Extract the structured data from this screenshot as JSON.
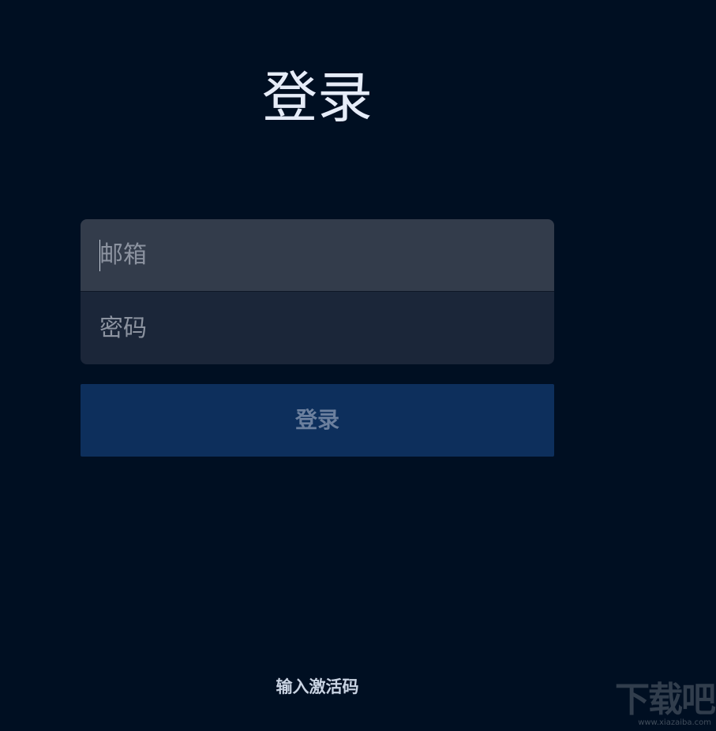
{
  "header": {
    "title": "登录"
  },
  "form": {
    "email": {
      "value": "",
      "placeholder": "邮箱"
    },
    "password": {
      "value": "",
      "placeholder": "密码"
    },
    "submit_label": "登录"
  },
  "footer": {
    "activation_label": "输入激活码"
  },
  "watermark": {
    "logo_text": "下载吧",
    "url_text": "www.xiazaiba.com"
  },
  "colors": {
    "background": "#000f22",
    "email_field": "#333c4b",
    "password_field": "#1b2639",
    "login_button": "#0d2f5c"
  }
}
